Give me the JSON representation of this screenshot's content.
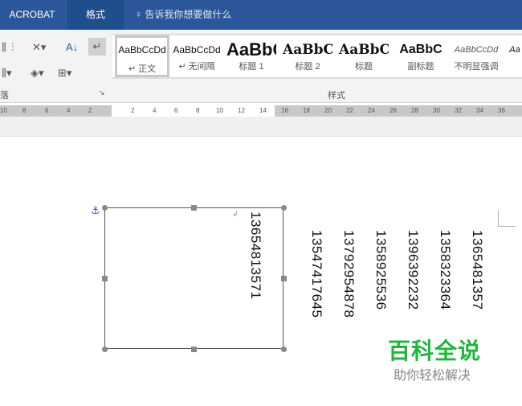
{
  "titlebar": {
    "tabs": [
      "ACROBAT",
      "格式"
    ],
    "tell_me": "告诉我你想要做什么"
  },
  "ribbon": {
    "paragraph_group_label": "落",
    "styles_group_label": "样式",
    "styles": [
      {
        "preview": "AaBbCcDd",
        "name": "↵ 正文"
      },
      {
        "preview": "AaBbCcDd",
        "name": "↵ 无间隔"
      },
      {
        "preview": "AaBbC",
        "name": "标题 1"
      },
      {
        "preview": "AaBbC",
        "name": "标题 2"
      },
      {
        "preview": "AaBbC",
        "name": "标题"
      },
      {
        "preview": "AaBbC",
        "name": "副标题"
      },
      {
        "preview": "AaBbCcDd",
        "name": "不明显强调"
      },
      {
        "preview": "Aa",
        "name": ""
      }
    ]
  },
  "ruler": {
    "left": [
      "10",
      "8",
      "6",
      "4",
      "2"
    ],
    "right": [
      "2",
      "4",
      "6",
      "8",
      "10",
      "12",
      "14",
      "16",
      "18",
      "20",
      "22",
      "24",
      "26",
      "28",
      "30",
      "32",
      "34",
      "36"
    ]
  },
  "document": {
    "textbox_number": "13654813571",
    "numbers": [
      "13547417645",
      "13792954878",
      "1358925536",
      "1396392232",
      "1358323364",
      "1365481357"
    ]
  },
  "watermark": {
    "title": "百科全说",
    "subtitle": "助你轻松解决",
    "color": "#1db83a"
  }
}
